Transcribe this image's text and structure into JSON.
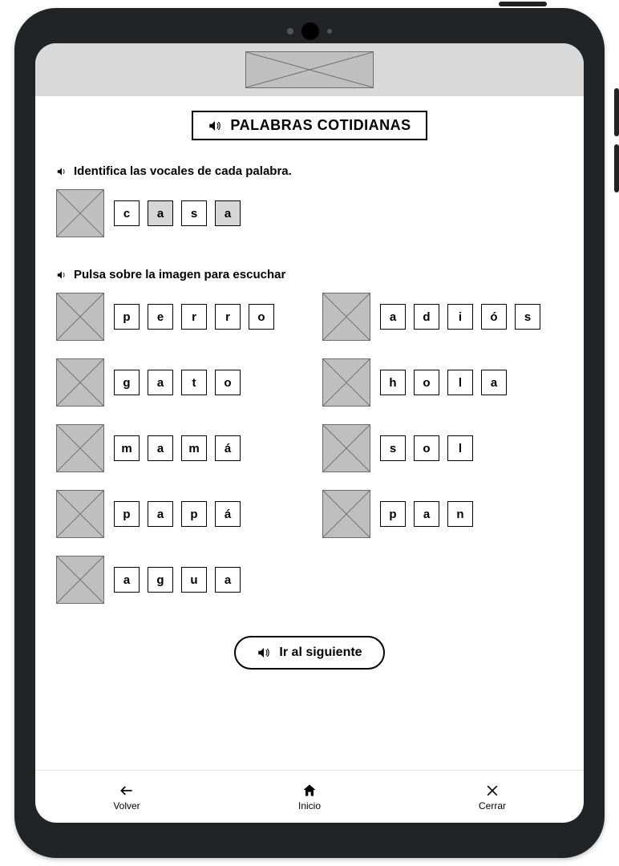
{
  "title": "PALABRAS COTIDIANAS",
  "instr1": "Identifica las vocales de cada palabra.",
  "instr2": "Pulsa sobre la imagen para escuchar",
  "example": {
    "letters": [
      "c",
      "a",
      "s",
      "a"
    ],
    "highlight": [
      false,
      true,
      false,
      true
    ]
  },
  "left": [
    {
      "letters": [
        "p",
        "e",
        "r",
        "r",
        "o"
      ]
    },
    {
      "letters": [
        "g",
        "a",
        "t",
        "o"
      ]
    },
    {
      "letters": [
        "m",
        "a",
        "m",
        "á"
      ]
    },
    {
      "letters": [
        "p",
        "a",
        "p",
        "á"
      ]
    },
    {
      "letters": [
        "a",
        "g",
        "u",
        "a"
      ]
    }
  ],
  "right": [
    {
      "letters": [
        "a",
        "d",
        "i",
        "ó",
        "s"
      ]
    },
    {
      "letters": [
        "h",
        "o",
        "l",
        "a"
      ]
    },
    {
      "letters": [
        "s",
        "o",
        "l"
      ]
    },
    {
      "letters": [
        "p",
        "a",
        "n"
      ]
    }
  ],
  "next_label": "Ir al siguiente",
  "nav": {
    "back": "Volver",
    "home": "Inicio",
    "close": "Cerrar"
  }
}
